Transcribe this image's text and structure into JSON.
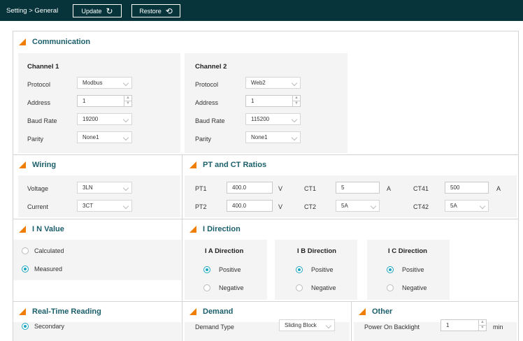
{
  "header": {
    "breadcrumb": "Setting > General",
    "update_label": "Update",
    "restore_label": "Restore"
  },
  "communication": {
    "title": "Communication",
    "channel1": {
      "title": "Channel 1",
      "protocol_label": "Protocol",
      "protocol_value": "Modbus",
      "address_label": "Address",
      "address_value": "1",
      "baud_label": "Baud Rate",
      "baud_value": "19200",
      "parity_label": "Parity",
      "parity_value": "None1"
    },
    "channel2": {
      "title": "Channel 2",
      "protocol_label": "Protocol",
      "protocol_value": "Web2",
      "address_label": "Address",
      "address_value": "1",
      "baud_label": "Baud Rate",
      "baud_value": "115200",
      "parity_label": "Parity",
      "parity_value": "None1"
    }
  },
  "wiring": {
    "title": "Wiring",
    "voltage_label": "Voltage",
    "voltage_value": "3LN",
    "current_label": "Current",
    "current_value": "3CT"
  },
  "ratios": {
    "title": "PT and CT Ratios",
    "pt1_label": "PT1",
    "pt1_value": "400.0",
    "pt1_unit": "V",
    "pt2_label": "PT2",
    "pt2_value": "400.0",
    "pt2_unit": "V",
    "ct1_label": "CT1",
    "ct1_value": "5",
    "ct1_unit": "A",
    "ct2_label": "CT2",
    "ct2_value": "5A",
    "ct41_label": "CT41",
    "ct41_value": "500",
    "ct41_unit": "A",
    "ct42_label": "CT42",
    "ct42_value": "5A"
  },
  "in_value": {
    "title": "I N Value",
    "calculated_label": "Calculated",
    "measured_label": "Measured",
    "selected": "Measured"
  },
  "direction": {
    "title": "I Direction",
    "a_title": "I A Direction",
    "b_title": "I B Direction",
    "c_title": "I C Direction",
    "positive_label": "Positive",
    "negative_label": "Negative",
    "a_selected": "Positive",
    "b_selected": "Positive",
    "c_selected": "Positive"
  },
  "realtime": {
    "title": "Real-Time Reading",
    "secondary_label": "Secondary",
    "selected": "Secondary"
  },
  "demand": {
    "title": "Demand",
    "type_label": "Demand Type",
    "type_value": "Sliding Block"
  },
  "other": {
    "title": "Other",
    "backlight_label": "Power On Backlight",
    "backlight_value": "1",
    "backlight_unit": "min"
  },
  "colors": {
    "header_bg": "#06343a",
    "title_text": "#1b5f6b",
    "accent_orange": "#ef7d00",
    "radio_selected": "#1fa6c2",
    "panel_bg": "#f4f4f4"
  }
}
